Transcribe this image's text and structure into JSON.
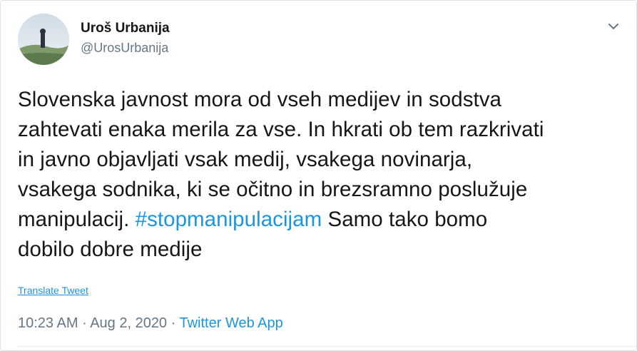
{
  "author": {
    "name": "Uroš Urbanija",
    "handle": "@UrosUrbanija"
  },
  "tweet": {
    "lines": [
      "Slovenska javnost mora od vseh medijev in sodstva",
      "zahtevati enaka merila za vse. In hkrati ob tem razkrivati",
      "in javno objavljati vsak medij, vsakega novinarja,",
      "vsakega sodnika, ki se očitno in brezsramno poslužuje"
    ],
    "line5_before": "manipulacij. ",
    "hashtag": "#stopmanipulacijam",
    "line5_after": " Samo tako bomo",
    "line6": "dobilo dobre medije"
  },
  "translate_label": "Translate Tweet",
  "meta": {
    "time": "10:23 AM",
    "separator": " · ",
    "date": "Aug 2, 2020",
    "source": "Twitter Web App"
  },
  "icons": {
    "menu": "chevron-down-icon"
  },
  "colors": {
    "text": "#14171a",
    "secondary": "#657786",
    "link": "#1b95e0"
  }
}
